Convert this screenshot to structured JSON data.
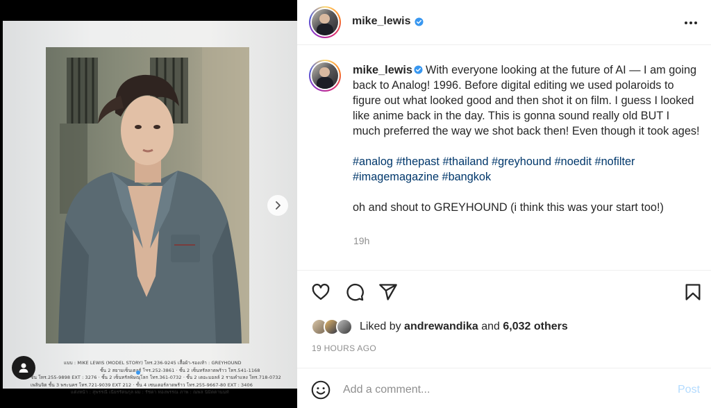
{
  "post": {
    "username": "mike_lewis",
    "verified": true,
    "caption": "With everyone looking at the future of AI — I am going back to Analog! 1996. Before digital editing we used polaroids to figure out what looked good and then shot it on film. I guess I looked like anime back in the day. This is gonna sound really old BUT I much preferred the way we shot back then! Even though it took ages!",
    "hashtags_line1": "#analog #thepast #thailand #greyhound #noedit #nofilter",
    "hashtags_line2": "#imagemagazine #bangkok",
    "shoutout": "oh and shout to GREYHOUND (i think this was your start too!)",
    "time": "19h"
  },
  "media": {
    "magazine_lines": [
      "แบบ : MIKE LEWIS (MODEL STORY) โทร.236-9245 เสื้อผ้า-รองเท้า : GREYHOUND",
      "ชั้น 2 สยามเซ็นเตอร์ โทร.252-3861 · ชั้น 2 เซ็นทรัลลาดพร้าว โทร.541-1168",
      "ชั้น โทร.255-9898 EXT : 3276 · ชั้น 2 เซ็นทรัลพิษณุโลก โทร.361-0732 · ชั้น 2 เดอะมอลล์ 2 รามคำแหง โทร.718-0732",
      "เพลินจิต ชั้น 3 พระนคร โทร.721-9039 EXT 212 · ชั้น 4 เซนเตอร์ลาดพร้าว โทร.255-9667-80 EXT : 3406",
      "แต่งหน้า : สุพรรณี เนียรรัตนกุล ผม : รัชดา ทองพรรณ ภาพ : ณพล นิมิตตานนท์"
    ],
    "slide_count": 2,
    "active_slide": 0
  },
  "engagement": {
    "liked_by_prefix": "Liked by",
    "liked_by_user": "andrewandika",
    "and_word": "and",
    "others": "6,032 others",
    "posted_ago": "19 HOURS AGO"
  },
  "comment": {
    "placeholder": "Add a comment...",
    "post_label": "Post"
  },
  "colors": {
    "link": "#00376b",
    "verified": "#3897f0",
    "post_disabled": "#b3dbff",
    "muted": "#8e8e8e"
  },
  "icons": [
    "verified-badge-icon",
    "more-icon",
    "chevron-right-icon",
    "user-tag-icon",
    "heart-icon",
    "comment-icon",
    "share-icon",
    "bookmark-icon",
    "emoji-icon"
  ]
}
